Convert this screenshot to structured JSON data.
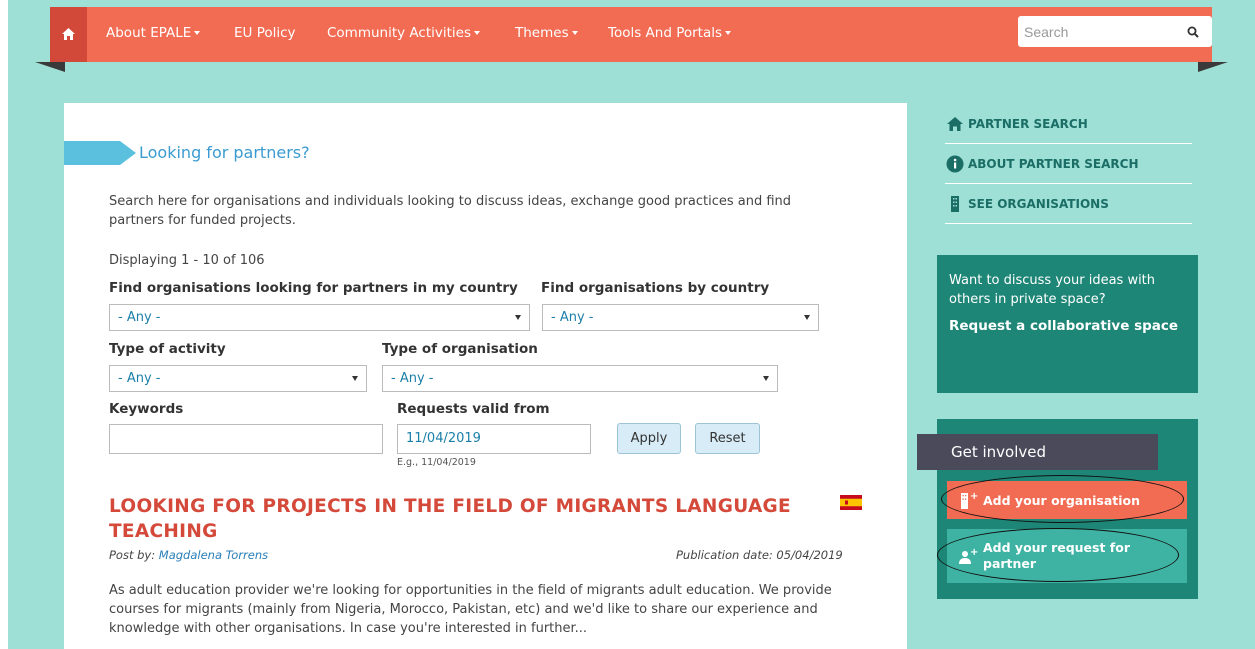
{
  "nav": {
    "items": [
      {
        "label": "About EPALE",
        "dropdown": true
      },
      {
        "label": "EU Policy",
        "dropdown": false
      },
      {
        "label": "Community Activities",
        "dropdown": true
      },
      {
        "label": "Themes",
        "dropdown": true
      },
      {
        "label": "Tools And Portals",
        "dropdown": true
      }
    ],
    "search_placeholder": "Search",
    "home_icon": "home-icon",
    "search_icon": "search-icon"
  },
  "main": {
    "title": "Looking for partners?",
    "intro": "Search here for organisations and individuals looking to discuss ideas, exchange good practices and find partners for funded projects.",
    "displaying": "Displaying 1 - 10 of 106",
    "filters": {
      "my_country_label": "Find organisations looking for partners in my country",
      "my_country_value": "- Any -",
      "by_country_label": "Find organisations by country",
      "by_country_value": "- Any -",
      "activity_label": "Type of activity",
      "activity_value": "- Any -",
      "org_type_label": "Type of organisation",
      "org_type_value": "- Any -",
      "keywords_label": "Keywords",
      "keywords_value": "",
      "valid_from_label": "Requests valid from",
      "valid_from_value": "11/04/2019",
      "valid_from_hint": "E.g., 11/04/2019",
      "apply_label": "Apply",
      "reset_label": "Reset"
    },
    "post": {
      "title": "LOOKING FOR PROJECTS IN THE FIELD OF MIGRANTS LANGUAGE TEACHING",
      "post_by_prefix": "Post by: ",
      "author": "Magdalena Torrens",
      "publication_date": "Publication date: 05/04/2019",
      "body": "As adult education provider we're looking for opportunities in the field of migrants adult education. We provide courses for migrants (mainly from Nigeria, Morocco, Pakistan, etc) and we'd like to share our experience and knowledge with other organisations. In case you're interested in further...",
      "flag_icon": "spain-flag-icon"
    }
  },
  "sidebar": {
    "links": [
      {
        "label": "PARTNER SEARCH",
        "icon": "home-icon"
      },
      {
        "label": "ABOUT PARTNER SEARCH",
        "icon": "info-icon"
      },
      {
        "label": "SEE ORGANISATIONS",
        "icon": "building-icon"
      }
    ],
    "collab_question": "Want to discuss your ideas with others in private space?",
    "collab_link": "Request a collaborative space",
    "get_involved": "Get involved",
    "add_org": "Add your organisation",
    "add_request": "Add your request for partner"
  },
  "colors": {
    "nav_bg": "#f26b53",
    "page_bg": "#9edfd6",
    "accent_teal": "#1e8676",
    "post_title": "#d4493a",
    "link_blue": "#3a9bd1"
  }
}
